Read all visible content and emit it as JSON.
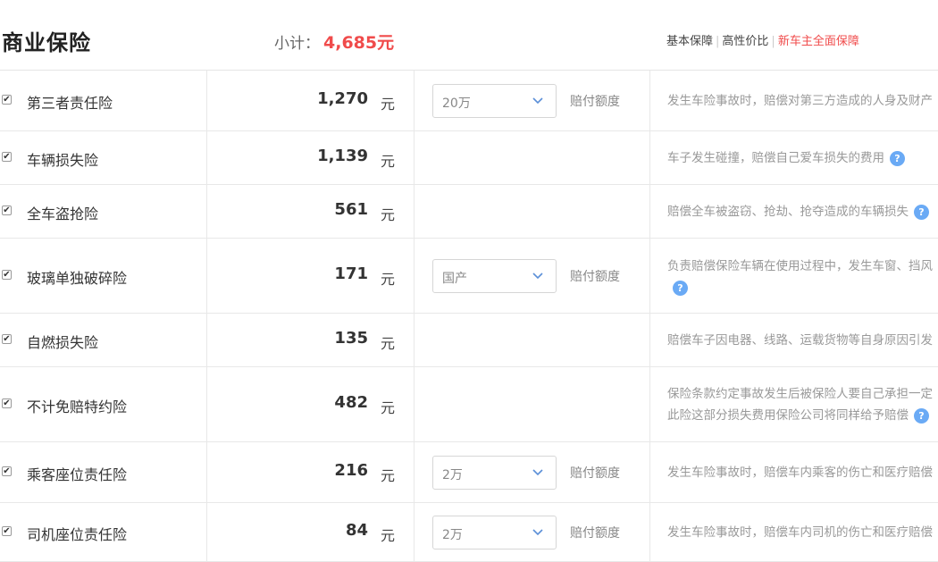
{
  "header": {
    "title": "商业保险",
    "subtotal_label": "小计：",
    "subtotal_value": "4,685元",
    "plans": [
      "基本保障",
      "高性价比",
      "新车主全面保障"
    ]
  },
  "rows": [
    {
      "name": "第三者责任险",
      "price": "1,270",
      "unit": "元",
      "select": "20万",
      "limit_label": "赔付额度",
      "desc": [
        "发生车险事故时，赔偿对第三方造成的人身及财产"
      ]
    },
    {
      "name": "车辆损失险",
      "price": "1,139",
      "unit": "元",
      "desc": [
        "车子发生碰撞，赔偿自己爱车损失的费用"
      ],
      "help": "?"
    },
    {
      "name": "全车盗抢险",
      "price": "561",
      "unit": "元",
      "desc": [
        "赔偿全车被盗窃、抢劫、抢夺造成的车辆损失"
      ],
      "help": "?"
    },
    {
      "name": "玻璃单独破碎险",
      "price": "171",
      "unit": "元",
      "select": "国产",
      "limit_label": "赔付额度",
      "desc": [
        "负责赔偿保险车辆在使用过程中，发生车窗、挡风"
      ],
      "help": "?"
    },
    {
      "name": "自燃损失险",
      "price": "135",
      "unit": "元",
      "desc": [
        "赔偿车子因电器、线路、运载货物等自身原因引发"
      ]
    },
    {
      "name": "不计免赔特约险",
      "price": "482",
      "unit": "元",
      "desc": [
        "保险条款约定事故发生后被保险人要自己承担一定",
        "此险这部分损失费用保险公司将同样给予赔偿"
      ],
      "help": "?"
    },
    {
      "name": "乘客座位责任险",
      "price": "216",
      "unit": "元",
      "select": "2万",
      "limit_label": "赔付额度",
      "desc": [
        "发生车险事故时，赔偿车内乘客的伤亡和医疗赔偿"
      ]
    },
    {
      "name": "司机座位责任险",
      "price": "84",
      "unit": "元",
      "select": "2万",
      "limit_label": "赔付额度",
      "desc": [
        "发生车险事故时，赔偿车内司机的伤亡和医疗赔偿"
      ]
    }
  ]
}
